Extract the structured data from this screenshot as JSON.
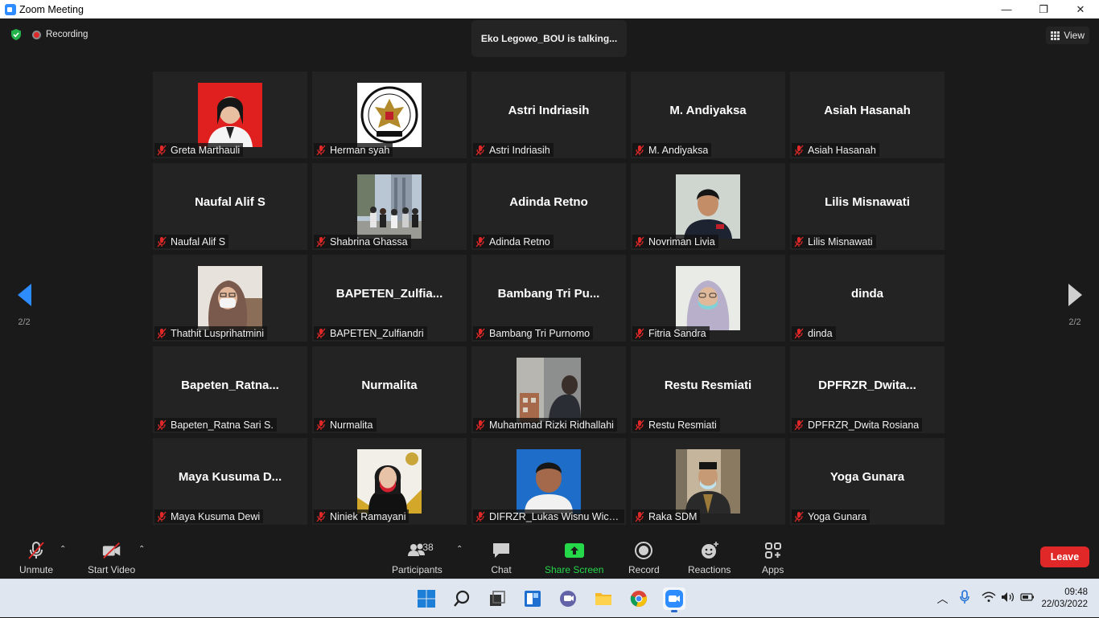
{
  "window": {
    "title": "Zoom Meeting",
    "minimize": "—",
    "restore": "❐",
    "close": "✕"
  },
  "topbar": {
    "recording_label": "Recording",
    "talking_text": "Eko Legowo_BOU is talking...",
    "view_label": "View"
  },
  "pagination": {
    "left": "2/2",
    "right": "2/2"
  },
  "tiles": [
    {
      "label": "Greta Marthauli",
      "display": "",
      "has_video": true,
      "pic": "greta"
    },
    {
      "label": "Herman syah",
      "display": "",
      "has_video": true,
      "pic": "bapeten-logo"
    },
    {
      "label": "Astri Indriasih",
      "display": "Astri Indriasih",
      "has_video": false
    },
    {
      "label": "M. Andiyaksa",
      "display": "M. Andiyaksa",
      "has_video": false
    },
    {
      "label": "Asiah Hasanah",
      "display": "Asiah Hasanah",
      "has_video": false
    },
    {
      "label": "Naufal Alif S",
      "display": "Naufal Alif S",
      "has_video": false
    },
    {
      "label": "Shabrina Ghassa",
      "display": "",
      "has_video": true,
      "pic": "shabrina"
    },
    {
      "label": "Adinda Retno",
      "display": "Adinda Retno",
      "has_video": false
    },
    {
      "label": "Novriman Livia",
      "display": "",
      "has_video": true,
      "pic": "novriman"
    },
    {
      "label": "Lilis Misnawati",
      "display": "Lilis Misnawati",
      "has_video": false
    },
    {
      "label": "Thathit Lusprihatmini",
      "display": "",
      "has_video": true,
      "pic": "thathit"
    },
    {
      "label": "BAPETEN_Zulfiandri",
      "display": "BAPETEN_Zulfia...",
      "has_video": false
    },
    {
      "label": "Bambang Tri Purnomo",
      "display": "Bambang Tri Pu...",
      "has_video": false
    },
    {
      "label": "Fitria Sandra",
      "display": "",
      "has_video": true,
      "pic": "fitria"
    },
    {
      "label": "dinda",
      "display": "dinda",
      "has_video": false
    },
    {
      "label": "Bapeten_Ratna Sari S.",
      "display": "Bapeten_Ratna...",
      "has_video": false
    },
    {
      "label": "Nurmalita",
      "display": "Nurmalita",
      "has_video": false
    },
    {
      "label": "Muhammad Rizki Ridhallahi",
      "display": "",
      "has_video": true,
      "pic": "rizki"
    },
    {
      "label": "Restu Resmiati",
      "display": "Restu Resmiati",
      "has_video": false
    },
    {
      "label": "DPFRZR_Dwita Rosiana",
      "display": "DPFRZR_Dwita...",
      "has_video": false
    },
    {
      "label": "Maya Kusuma Dewi",
      "display": "Maya Kusuma D...",
      "has_video": false
    },
    {
      "label": "Niniek Ramayani",
      "display": "",
      "has_video": true,
      "pic": "niniek"
    },
    {
      "label": "DIFRZR_Lukas Wisnu Wicak...",
      "display": "",
      "has_video": true,
      "pic": "lukas"
    },
    {
      "label": "Raka SDM",
      "display": "",
      "has_video": true,
      "pic": "raka"
    },
    {
      "label": "Yoga Gunara",
      "display": "Yoga Gunara",
      "has_video": false
    }
  ],
  "toolbar": {
    "unmute": "Unmute",
    "start_video": "Start Video",
    "participants": "Participants",
    "participants_count": "38",
    "chat": "Chat",
    "share_screen": "Share Screen",
    "record": "Record",
    "reactions": "Reactions",
    "apps": "Apps",
    "leave": "Leave"
  },
  "taskbar": {
    "time": "09:48",
    "date": "22/03/2022"
  },
  "colors": {
    "accent": "#2d8cff",
    "leave": "#e02828",
    "share": "#24d84a",
    "tile_bg": "#232323",
    "meeting_bg": "#1a1a1a"
  }
}
